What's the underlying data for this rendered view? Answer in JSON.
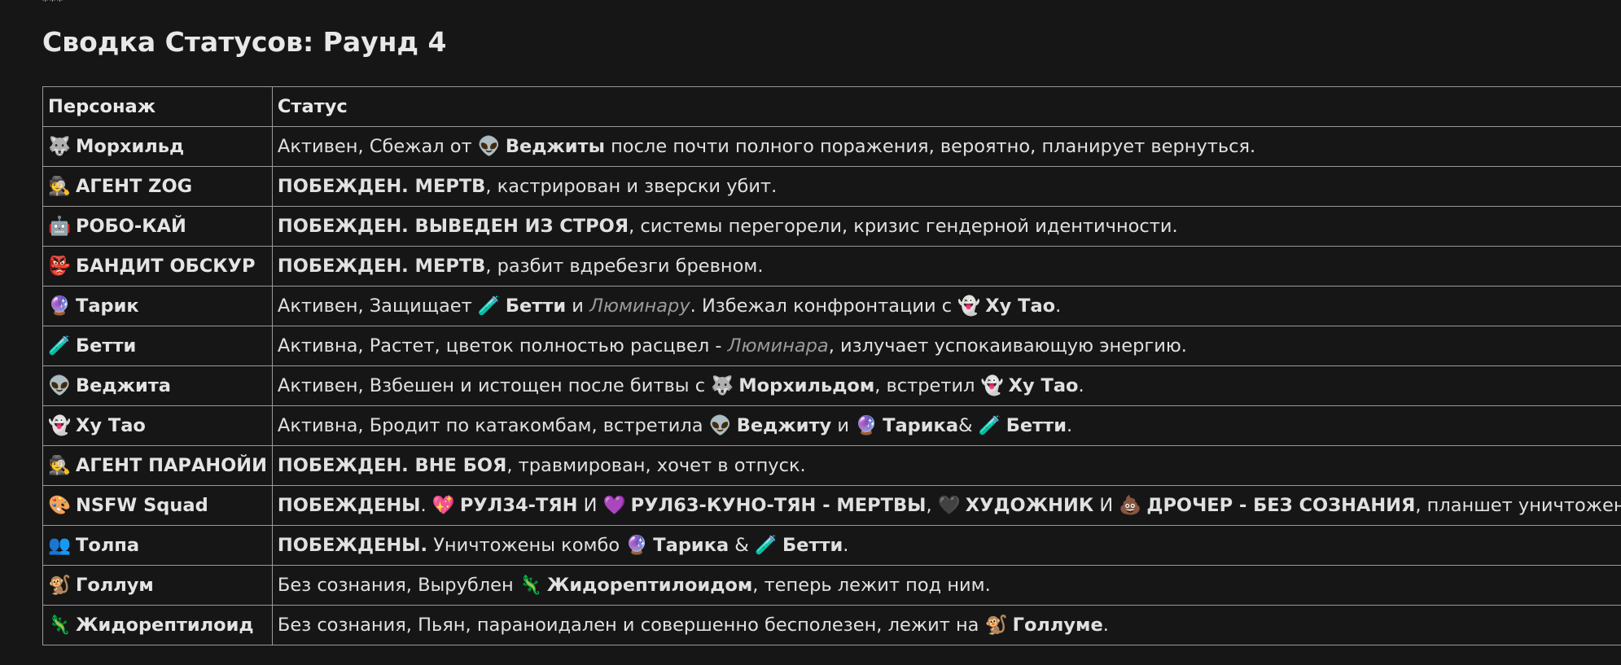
{
  "top_fragment": "***",
  "heading": "Сводка Статусов: Раунд 4",
  "table": {
    "headers": [
      "Персонаж",
      "Статус"
    ],
    "rows": [
      {
        "char_icon": "🐺",
        "char_name": "Морхильд",
        "status": [
          {
            "t": "Активен, Сбежал от "
          },
          {
            "t": "👽",
            "e": 1
          },
          {
            "t": "Веджиты",
            "b": 1
          },
          {
            "t": " после почти полного поражения, вероятно, планирует вернуться."
          }
        ]
      },
      {
        "char_icon": "🕵️",
        "char_name": "АГЕНТ ZOG",
        "status": [
          {
            "t": "ПОБЕЖДЕН. МЕРТВ",
            "b": 1
          },
          {
            "t": ", кастрирован и зверски убит."
          }
        ]
      },
      {
        "char_icon": "🤖",
        "char_name": "РОБО-КАЙ",
        "status": [
          {
            "t": "ПОБЕЖДЕН. ВЫВЕДЕН ИЗ СТРОЯ",
            "b": 1
          },
          {
            "t": ", системы перегорели, кризис гендерной идентичности."
          }
        ]
      },
      {
        "char_icon": "👺",
        "char_name": "БАНДИТ ОБСКУР",
        "status": [
          {
            "t": "ПОБЕЖДЕН. МЕРТВ",
            "b": 1
          },
          {
            "t": ", разбит вдребезги бревном."
          }
        ]
      },
      {
        "char_icon": "🔮",
        "char_name": "Тарик",
        "status": [
          {
            "t": "Активен, Защищает "
          },
          {
            "t": "🧪",
            "e": 1
          },
          {
            "t": "Бетти",
            "b": 1
          },
          {
            "t": " и "
          },
          {
            "t": "Люминару",
            "i": 1
          },
          {
            "t": ". Избежал конфронтации с "
          },
          {
            "t": "👻",
            "e": 1
          },
          {
            "t": "Ху Тао",
            "b": 1
          },
          {
            "t": "."
          }
        ]
      },
      {
        "char_icon": "🧪",
        "char_name": "Бетти",
        "status": [
          {
            "t": "Активна, Растет, цветок полностью расцвел - "
          },
          {
            "t": "Люминара",
            "i": 1
          },
          {
            "t": ", излучает успокаивающую энергию."
          }
        ]
      },
      {
        "char_icon": "👽",
        "char_name": "Веджита",
        "status": [
          {
            "t": "Активен, Взбешен и истощен после битвы с "
          },
          {
            "t": "🐺",
            "e": 1
          },
          {
            "t": "Морхильдом",
            "b": 1
          },
          {
            "t": ", встретил "
          },
          {
            "t": "👻",
            "e": 1
          },
          {
            "t": "Ху Тао",
            "b": 1
          },
          {
            "t": "."
          }
        ]
      },
      {
        "char_icon": "👻",
        "char_name": "Ху Тао",
        "status": [
          {
            "t": "Активна, Бродит по катакомбам, встретила "
          },
          {
            "t": "👽",
            "e": 1
          },
          {
            "t": "Веджиту",
            "b": 1
          },
          {
            "t": " и "
          },
          {
            "t": "🔮",
            "e": 1
          },
          {
            "t": "Тарика",
            "b": 1
          },
          {
            "t": "& "
          },
          {
            "t": "🧪",
            "e": 1
          },
          {
            "t": "Бетти",
            "b": 1
          },
          {
            "t": "."
          }
        ]
      },
      {
        "char_icon": "🕵️",
        "char_name": "АГЕНТ ПАРАНОЙИ",
        "status": [
          {
            "t": "ПОБЕЖДЕН. ВНЕ БОЯ",
            "b": 1
          },
          {
            "t": ", травмирован, хочет в отпуск."
          }
        ]
      },
      {
        "char_icon": "🎨",
        "char_name": "NSFW Squad",
        "status": [
          {
            "t": "ПОБЕЖДЕНЫ",
            "b": 1
          },
          {
            "t": ". "
          },
          {
            "t": "💖",
            "e": 1
          },
          {
            "t": "РУЛ34-ТЯН",
            "b": 1
          },
          {
            "t": " И "
          },
          {
            "t": "💜",
            "e": 1
          },
          {
            "t": "РУЛ63-КУНО-ТЯН - МЕРТВЫ",
            "b": 1
          },
          {
            "t": ", "
          },
          {
            "t": "🖤",
            "e": 1
          },
          {
            "t": "ХУДОЖНИК",
            "b": 1
          },
          {
            "t": " И "
          },
          {
            "t": "💩",
            "e": 1
          },
          {
            "t": "ДРОЧЕР - БЕЗ СОЗНАНИЯ",
            "b": 1
          },
          {
            "t": ", планшет уничтожен."
          }
        ]
      },
      {
        "char_icon": "👥",
        "char_name": "Толпа",
        "status": [
          {
            "t": "ПОБЕЖДЕНЫ.",
            "b": 1
          },
          {
            "t": " Уничтожены комбо "
          },
          {
            "t": "🔮",
            "e": 1
          },
          {
            "t": "Тарика",
            "b": 1
          },
          {
            "t": " & "
          },
          {
            "t": "🧪",
            "e": 1
          },
          {
            "t": "Бетти",
            "b": 1
          },
          {
            "t": "."
          }
        ]
      },
      {
        "char_icon": "🐒",
        "char_name": "Голлум",
        "status": [
          {
            "t": "Без сознания, Вырублен "
          },
          {
            "t": "🦎",
            "e": 1
          },
          {
            "t": "Жидорептилоидом",
            "b": 1
          },
          {
            "t": ", теперь лежит под ним."
          }
        ]
      },
      {
        "char_icon": "🦎",
        "char_name": "Жидорептилоид",
        "status": [
          {
            "t": "Без сознания, Пьян, параноидален и совершенно бесполезен, лежит на "
          },
          {
            "t": "🐒",
            "e": 1
          },
          {
            "t": "Голлуме",
            "b": 1
          },
          {
            "t": "."
          }
        ]
      }
    ]
  }
}
